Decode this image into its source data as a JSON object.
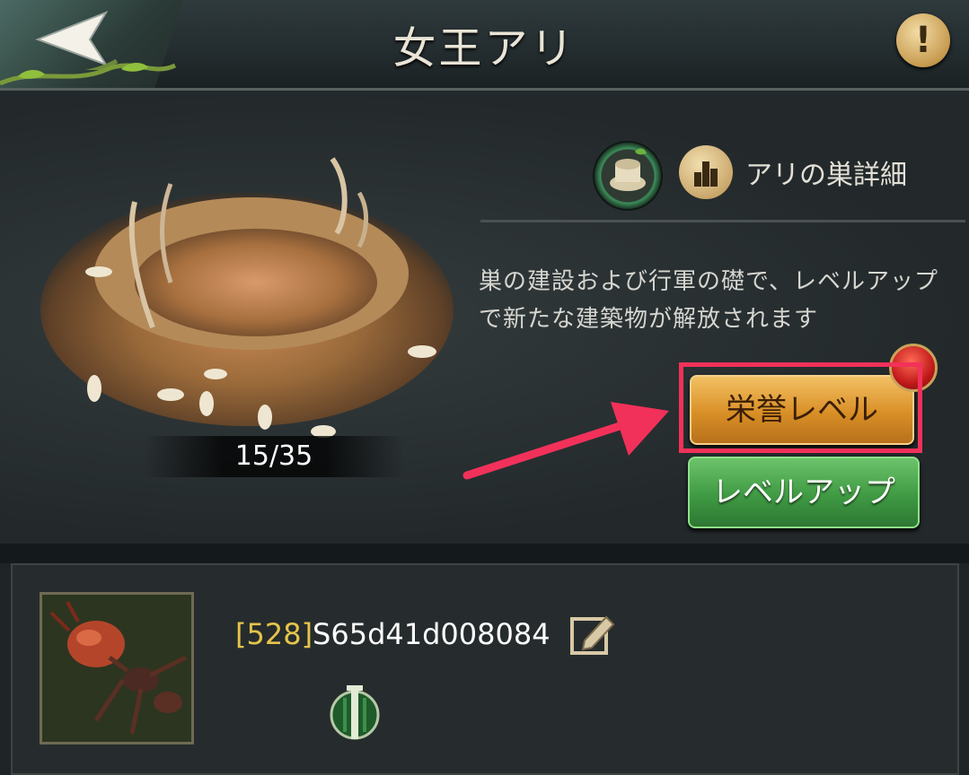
{
  "header": {
    "title": "女王アリ",
    "back_icon": "back-arrow-icon",
    "info_icon": "exclamation-icon",
    "info_glyph": "!"
  },
  "building": {
    "progress": "15/35",
    "detail_icon": "nest-detail-icon",
    "chart_icon": "bar-chart-icon",
    "detail_label": "アリの巣詳細",
    "description": "巣の建設および行軍の礎で、レベルアップで新たな建築物が解放されます"
  },
  "actions": {
    "honor_level": "栄誉レベル",
    "level_up": "レベルアップ",
    "highlight_color": "#f2315a",
    "honor_color": "#d98f26",
    "level_up_color": "#3f9a43"
  },
  "player": {
    "level": "[528]",
    "name": "S65d41d008084",
    "edit_icon": "pencil-edit-icon",
    "rank_icon": "green-rank-badge-icon"
  }
}
